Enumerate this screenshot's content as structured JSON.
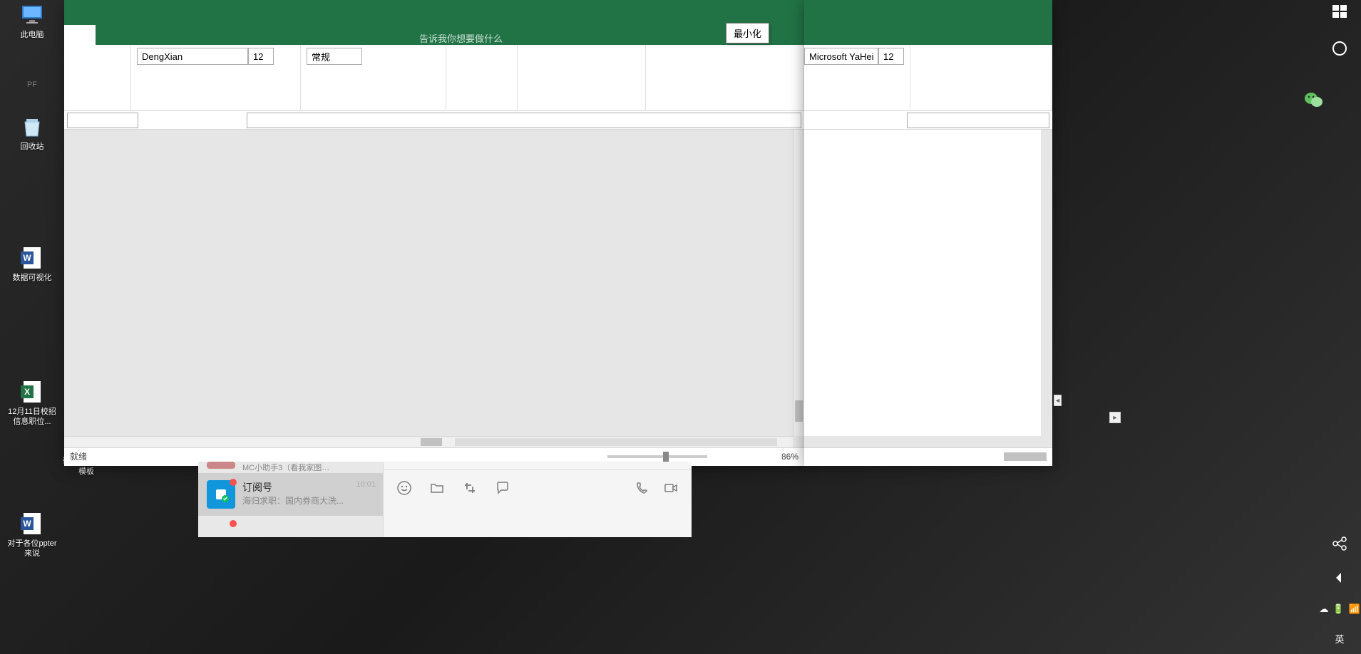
{
  "desktop": {
    "icons": [
      {
        "label": "此电脑"
      },
      {
        "label": "PF"
      },
      {
        "label": "回收站"
      },
      {
        "label": "数据可视化"
      },
      {
        "label": "12月11日校招信息职位..."
      },
      {
        "label": "对于各位ppter来说"
      },
      {
        "label": "学"
      },
      {
        "label": "微信文章头图模板"
      }
    ]
  },
  "excel1": {
    "font_name": "DengXian",
    "font_size": "12",
    "style_name": "常规",
    "tellme": "告诉我你想要做什么",
    "status": "就绪",
    "zoom": "86%",
    "tooltip_minimize": "最小化"
  },
  "excel2": {
    "font_name": "Microsoft YaHei l",
    "font_size": "12"
  },
  "wechat": {
    "items": [
      {
        "name": "MC小助手3（看我家图…",
        "time": ""
      },
      {
        "name": "订阅号",
        "preview": "海归求职：国内券商大洗...",
        "time": "10:01"
      }
    ]
  },
  "rightbar": {
    "ime": "英"
  }
}
